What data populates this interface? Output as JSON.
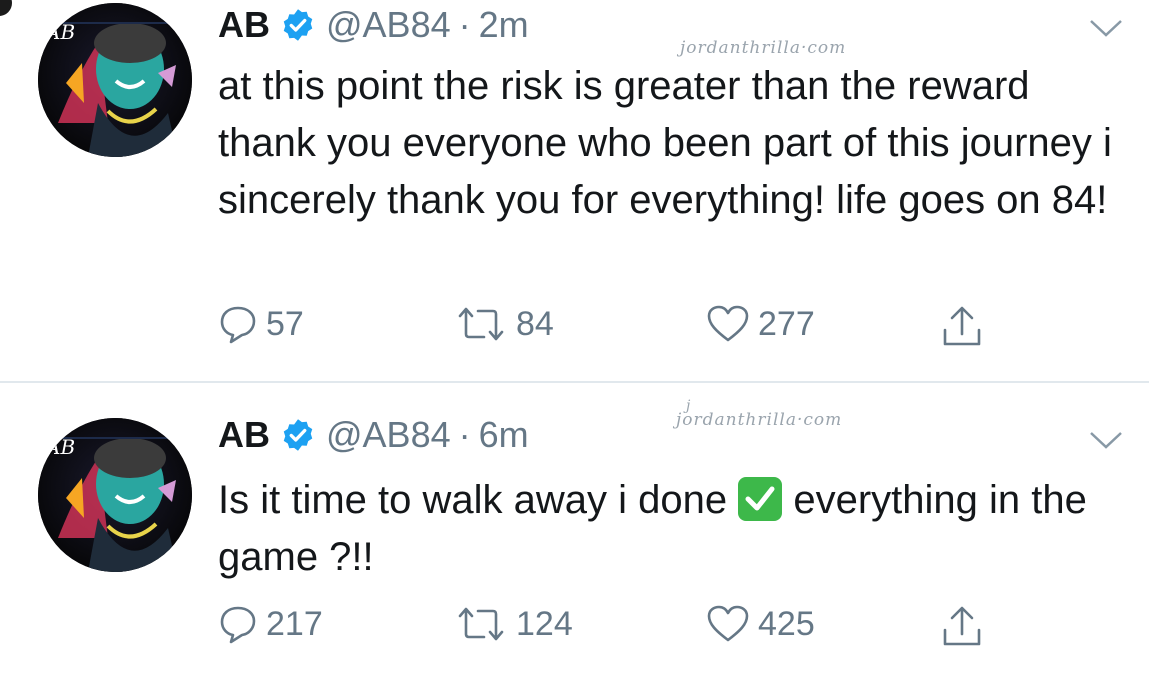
{
  "watermark": "jordanthrilla·com",
  "watermark_j": "j",
  "colors": {
    "verified": "#1da1f2",
    "muted": "#657786",
    "text": "#14171a",
    "check_emoji": "#3db84a"
  },
  "tweets": [
    {
      "avatar_initials": "AB",
      "name": "AB",
      "handle": "@AB84",
      "separator": "·",
      "time": "2m",
      "text": "at this point the risk is greater than the reward thank you everyone who been part of this journey i sincerely thank you for everything! life goes on 84!",
      "replies": "57",
      "retweets": "84",
      "likes": "277"
    },
    {
      "avatar_initials": "AB",
      "name": "AB",
      "handle": "@AB84",
      "separator": "·",
      "time": "6m",
      "text_before": "Is it time to walk away i done",
      "text_after": "everything in the game ?!!",
      "replies": "217",
      "retweets": "124",
      "likes": "425"
    }
  ]
}
